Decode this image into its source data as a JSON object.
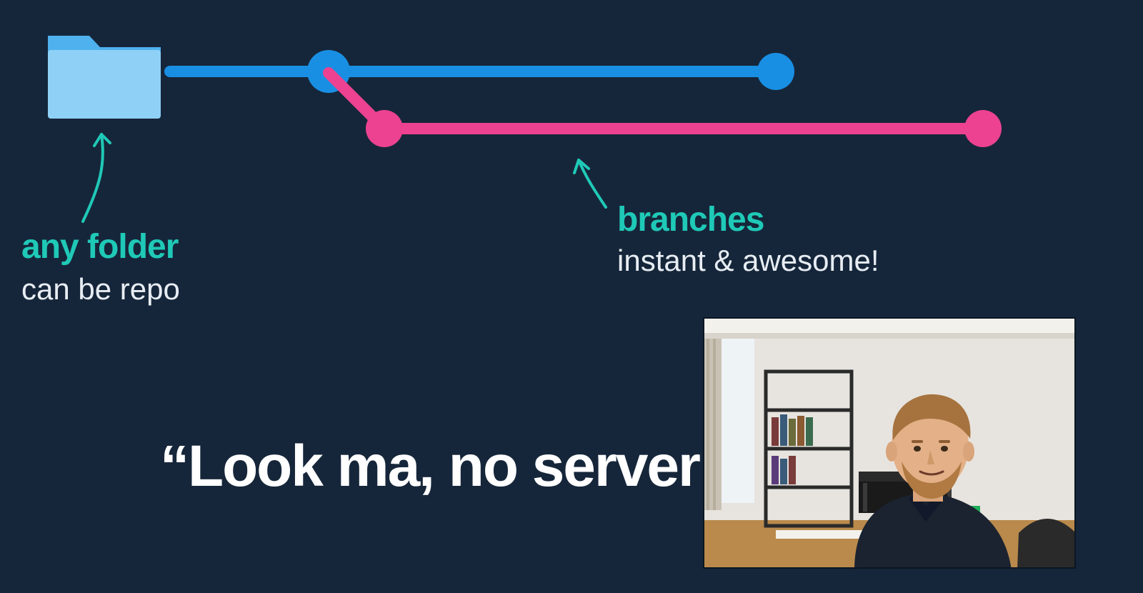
{
  "folder_callout": {
    "heading": "any folder",
    "sub": "can be repo"
  },
  "branches_callout": {
    "heading": "branches",
    "sub": "instant & awesome!"
  },
  "tagline": "“Look ma, no server",
  "colors": {
    "bg": "#16263a",
    "teal": "#1fc9b7",
    "blue": "#198fe3",
    "folder_light": "#8fd0f7",
    "folder_dark": "#4fb1ee",
    "pink": "#ec4291",
    "white": "#ffffff"
  },
  "diagram": {
    "folder_icon": "folder-icon",
    "branch_nodes": [
      {
        "id": "root",
        "color": "blue"
      },
      {
        "id": "main-tip",
        "color": "blue"
      },
      {
        "id": "feature-start",
        "color": "pink"
      },
      {
        "id": "feature-tip",
        "color": "pink"
      }
    ]
  }
}
